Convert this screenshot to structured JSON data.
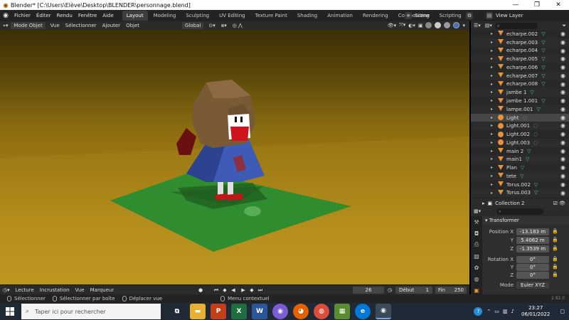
{
  "window": {
    "title": "Blender* [C:\\Users\\Elève\\Desktop\\BLENDER\\personnage.blend]",
    "minimize": "—",
    "maximize": "❐",
    "close": "✕"
  },
  "menubar": {
    "menus": [
      "Fichier",
      "Éditer",
      "Rendu",
      "Fenêtre",
      "Aide"
    ],
    "workspaces": [
      "Layout",
      "Modeling",
      "Sculpting",
      "UV Editing",
      "Texture Paint",
      "Shading",
      "Animation",
      "Rendering",
      "Compositing",
      "Scripting"
    ],
    "active_workspace": "Layout",
    "scene_label": "Scene",
    "view_layer_label": "View Layer"
  },
  "viewport_header": {
    "mode": "Mode Objet",
    "menus": [
      "Vue",
      "Sélectionner",
      "Ajouter",
      "Objet"
    ],
    "orientation": "Global"
  },
  "outliner": {
    "items": [
      {
        "name": "echarpe.002",
        "type": "mesh",
        "selected": false
      },
      {
        "name": "echarpe.003",
        "type": "mesh",
        "selected": false
      },
      {
        "name": "echarpe.004",
        "type": "mesh",
        "selected": false
      },
      {
        "name": "echarpe.005",
        "type": "mesh",
        "selected": false
      },
      {
        "name": "echarpe.006",
        "type": "mesh",
        "selected": false
      },
      {
        "name": "echarpe.007",
        "type": "mesh",
        "selected": false
      },
      {
        "name": "echarpe.008",
        "type": "mesh",
        "selected": false
      },
      {
        "name": "jambe 1",
        "type": "mesh",
        "selected": false
      },
      {
        "name": "jambe 1.001",
        "type": "mesh",
        "selected": false
      },
      {
        "name": "lampe.001",
        "type": "mesh",
        "selected": false
      },
      {
        "name": "Light",
        "type": "light",
        "selected": true
      },
      {
        "name": "Light.001",
        "type": "light",
        "selected": false
      },
      {
        "name": "Light.002",
        "type": "light",
        "selected": false
      },
      {
        "name": "Light.003",
        "type": "light",
        "selected": false
      },
      {
        "name": "main 2",
        "type": "mesh",
        "selected": false
      },
      {
        "name": "main1",
        "type": "mesh",
        "selected": false
      },
      {
        "name": "Plan",
        "type": "mesh",
        "selected": false
      },
      {
        "name": "tete",
        "type": "mesh",
        "selected": false
      },
      {
        "name": "Torus.002",
        "type": "mesh",
        "selected": false
      },
      {
        "name": "Torus.003",
        "type": "mesh",
        "selected": false
      }
    ],
    "collection2": "Collection 2"
  },
  "properties": {
    "panel_title": "Transformer",
    "position": {
      "label": "Position X",
      "x": "-13.183 m",
      "y": "5.4062 m",
      "z": "-1.3539 m"
    },
    "rotation": {
      "label": "Rotation X",
      "x": "0°",
      "y": "0°",
      "z": "0°"
    },
    "axis_y": "Y",
    "axis_z": "Z",
    "mode_label": "Mode",
    "mode_value": "Euler XYZ"
  },
  "timeline": {
    "menus": [
      "Lecture",
      "Incrustation",
      "Vue",
      "Marqueur"
    ],
    "current_frame": "26",
    "start_label": "Début",
    "start": "1",
    "end_label": "Fin",
    "end": "250"
  },
  "statusbar": {
    "select": "Sélectionner",
    "box_select": "Sélectionner par boîte",
    "move_view": "Déplacer vue",
    "context_menu": "Menu contextuel",
    "version": "2.92.0"
  },
  "taskbar": {
    "search_placeholder": "Taper ici pour rechercher",
    "time": "23:27",
    "date": "06/01/2022"
  },
  "colors": {
    "accent": "#4772b3",
    "mesh_icon": "#e8923a",
    "data_icon": "#4ec5a8",
    "floor": "#2f8c2f"
  }
}
